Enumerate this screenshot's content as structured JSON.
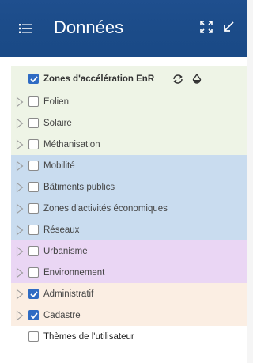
{
  "header": {
    "title": "Données",
    "menu_icon": "menu-list-icon",
    "expand_icon": "expand-icon",
    "collapse_icon": "collapse-arrow-icon",
    "background": "#1b4b88"
  },
  "layers": {
    "top_group": {
      "label": "Zones d'accélération EnR",
      "checked": true,
      "tools": [
        "refresh-icon",
        "opacity-drop-icon"
      ]
    },
    "items": [
      {
        "label": "Eolien",
        "checked": false,
        "group": "green"
      },
      {
        "label": "Solaire",
        "checked": false,
        "group": "green"
      },
      {
        "label": "Méthanisation",
        "checked": false,
        "group": "green"
      },
      {
        "label": "Mobilité",
        "checked": false,
        "group": "blue"
      },
      {
        "label": "Bâtiments publics",
        "checked": false,
        "group": "blue"
      },
      {
        "label": "Zones d'activités économiques",
        "checked": false,
        "group": "blue"
      },
      {
        "label": "Réseaux",
        "checked": false,
        "group": "blue"
      },
      {
        "label": "Urbanisme",
        "checked": false,
        "group": "purple"
      },
      {
        "label": "Environnement",
        "checked": false,
        "group": "purple"
      },
      {
        "label": "Administratif",
        "checked": true,
        "group": "peach"
      },
      {
        "label": "Cadastre",
        "checked": true,
        "group": "peach"
      }
    ],
    "user_themes": {
      "label": "Thèmes de l'utilisateur",
      "checked": false
    }
  },
  "colors": {
    "green": "#eef4e6",
    "blue": "#c9dcef",
    "purple": "#ead6f4",
    "peach": "#fbeee3",
    "checkbox_checked": "#2f6bc3"
  }
}
